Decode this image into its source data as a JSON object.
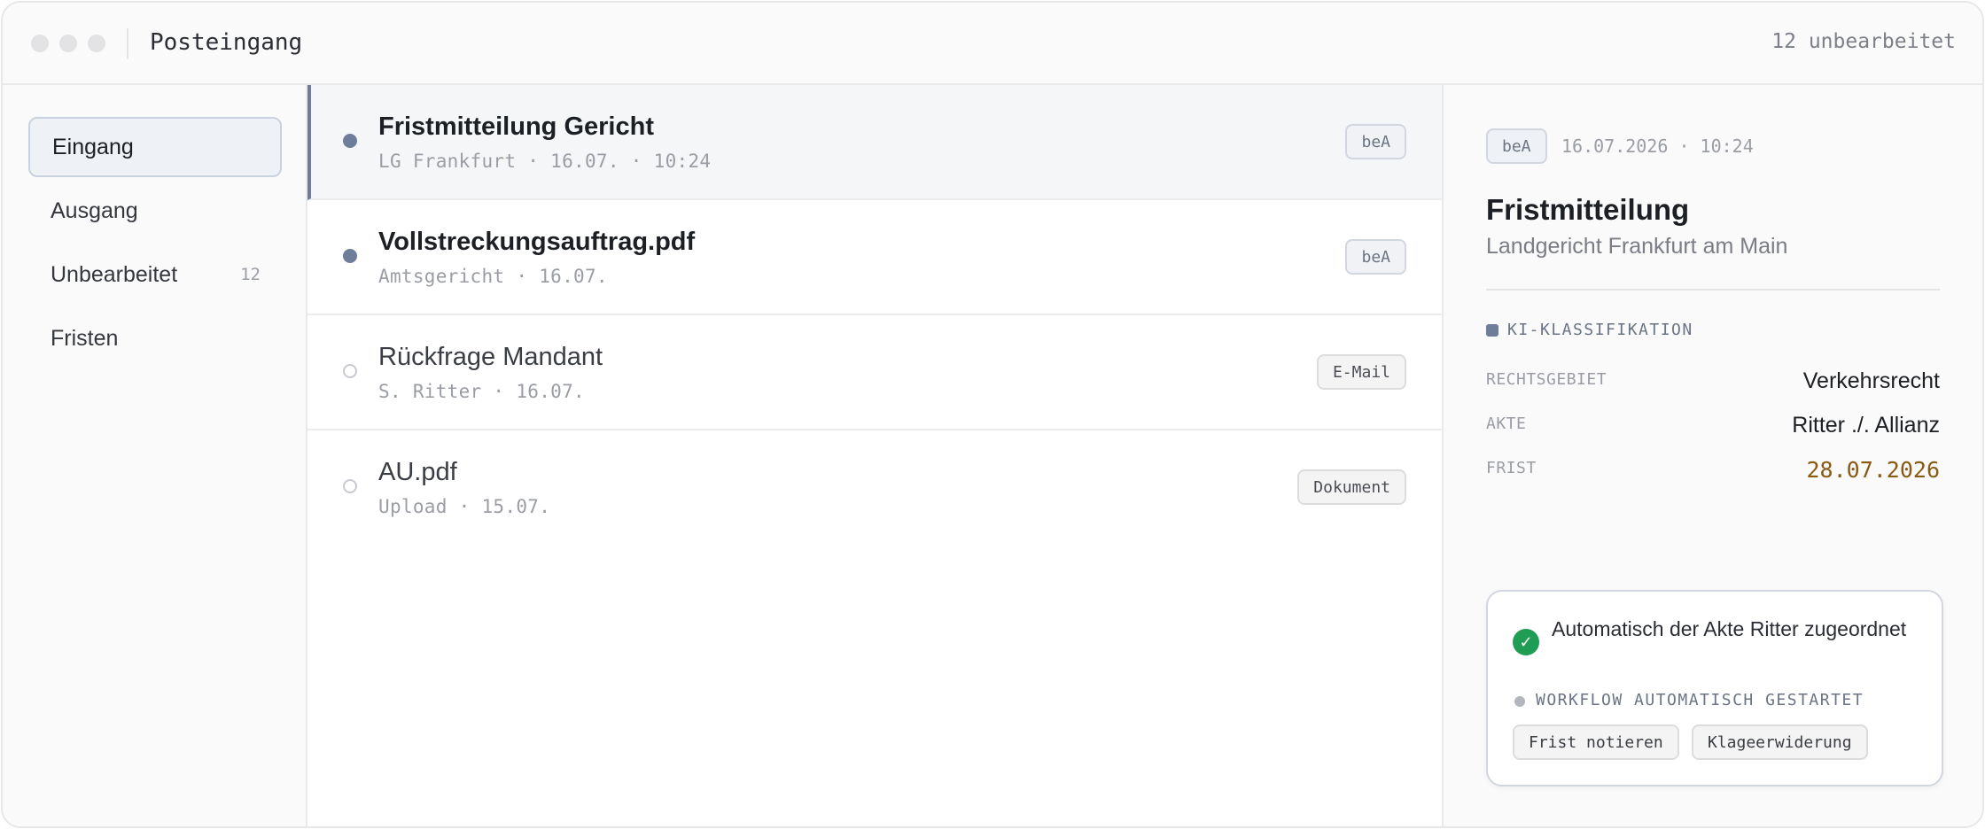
{
  "titlebar": {
    "title": "Posteingang",
    "status": "12 unbearbeitet"
  },
  "sidebar": {
    "items": [
      {
        "label": "Eingang",
        "count": ""
      },
      {
        "label": "Ausgang",
        "count": ""
      },
      {
        "label": "Unbearbeitet",
        "count": "12"
      },
      {
        "label": "Fristen",
        "count": ""
      }
    ]
  },
  "messages": [
    {
      "title": "Fristmitteilung Gericht",
      "subtitle": "LG Frankfurt · 16.07. · 10:24",
      "tag": "beA"
    },
    {
      "title": "Vollstreckungsauftrag.pdf",
      "subtitle": "Amtsgericht · 16.07.",
      "tag": "beA"
    },
    {
      "title": "Rückfrage Mandant",
      "subtitle": "S. Ritter · 16.07.",
      "tag": "E-Mail"
    },
    {
      "title": "AU.pdf",
      "subtitle": "Upload · 15.07.",
      "tag": "Dokument"
    }
  ],
  "detail": {
    "tag": "beA",
    "datetime": "16.07.2026 · 10:24",
    "title": "Fristmitteilung",
    "subtitle": "Landgericht Frankfurt am Main",
    "ki_label": "KI-KLASSIFIKATION",
    "fields": [
      {
        "key": "RECHTSGEBIET",
        "value": "Verkehrsrecht"
      },
      {
        "key": "AKTE",
        "value": "Ritter ./. Allianz"
      },
      {
        "key": "FRIST",
        "value": "28.07.2026"
      }
    ],
    "card": {
      "message": "Automatisch der Akte Ritter zugeordnet",
      "workflow_label": "WORKFLOW AUTOMATISCH GESTARTET",
      "actions": [
        "Frist notieren",
        "Klageerwiderung"
      ]
    }
  },
  "colors": {
    "accent": "#6e7d99",
    "success": "#1f9d55",
    "deadline": "#8a5a12"
  }
}
